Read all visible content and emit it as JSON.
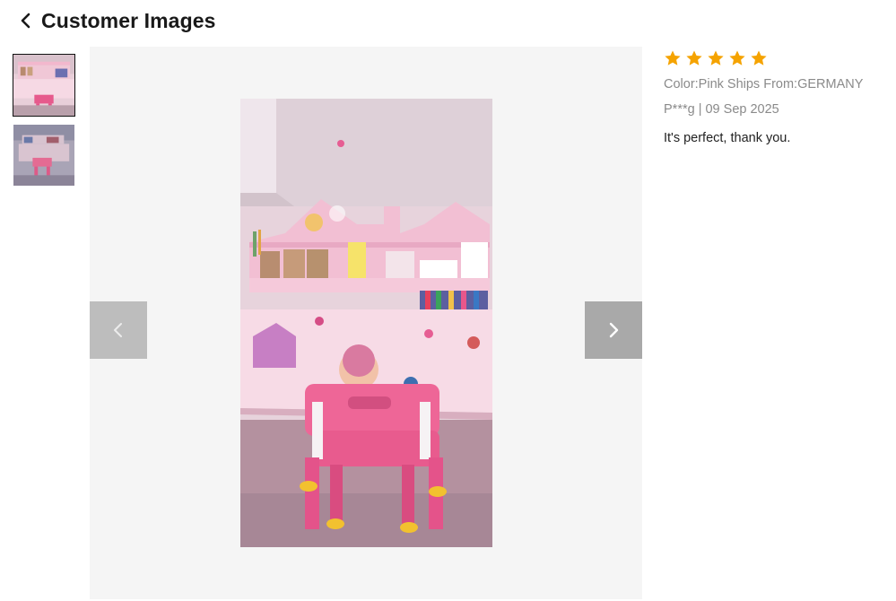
{
  "header": {
    "back_icon": "chevron-left-icon",
    "title": "Customer Images"
  },
  "thumbnails": [
    {
      "name": "thumbnail-1",
      "selected": true
    },
    {
      "name": "thumbnail-2",
      "selected": false
    }
  ],
  "viewer": {
    "prev_icon": "chevron-left-icon",
    "next_icon": "chevron-right-icon"
  },
  "review": {
    "rating": 5,
    "rating_max": 5,
    "star_color": "#f5a300",
    "variant": "Color:Pink Ships From:GERMANY",
    "author_date": "P***g | 09 Sep 2025",
    "text": "It's perfect, thank you."
  }
}
